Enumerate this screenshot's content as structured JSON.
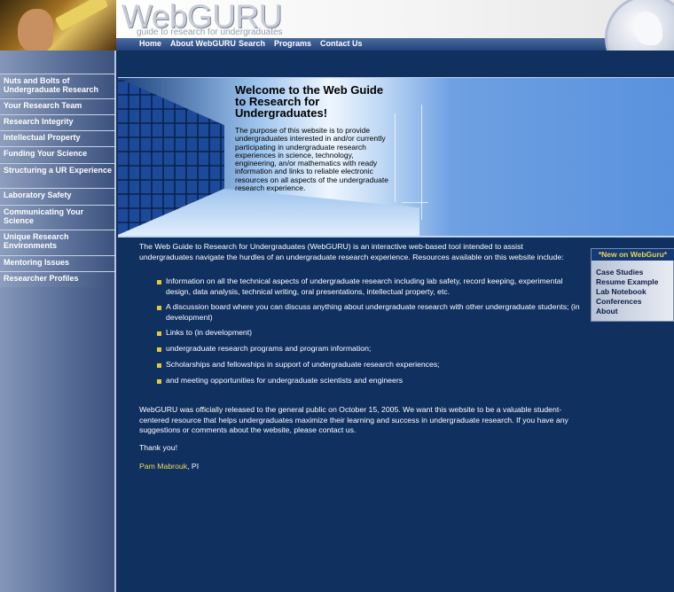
{
  "header": {
    "logo": "WebGURU",
    "tagline": "guide to research for undergraduates",
    "nav": [
      "Home",
      "About WebGURU",
      "Search",
      "Programs",
      "Contact Us"
    ]
  },
  "sidebar": {
    "items": [
      {
        "label": "Nuts and Bolts of Undergraduate Research"
      },
      {
        "label": "Your Research Team"
      },
      {
        "label": "Research Integrity"
      },
      {
        "label": "Intellectual Property"
      },
      {
        "label": "Funding Your Science"
      },
      {
        "label": "Structuring a UR Experience"
      },
      {
        "label": "Laboratory Safety"
      },
      {
        "label": "Communicating Your Science"
      },
      {
        "label": "Unique Research Environments"
      },
      {
        "label": "Mentoring Issues"
      },
      {
        "label": "Researcher Profiles"
      }
    ]
  },
  "hero": {
    "title": "Welcome to the Web Guide to Research for Undergraduates!",
    "text": "The purpose of this website is to provide undergraduates interested in and/or currently participating in undergraduate research experiences in science, technology, engineering, an/or mathematics with ready information and links to reliable electronic resources on all aspects of the undergraduate research experience."
  },
  "main": {
    "intro": "The Web Guide to Research for Undergraduates (WebGURU) is an interactive web-based tool intended to assist undergraduates navigate the hurdles of an undergraduate research experience. Resources available on this website include:",
    "bullets": [
      "Information on all the technical aspects of undergraduate research including lab safety, record keeping, experimental design, data analysis, technical writing, oral presentations, intellectual property, etc.",
      "A discussion board where you can discuss anything about undergraduate research with other undergraduate students; (in development)",
      "Links to (in development)",
      "undergraduate research programs and program information;",
      "Scholarships and fellowships in support of undergraduate research experiences;",
      "and meeting opportunities for undergraduate scientists and engineers"
    ],
    "para2": "WebGURU was officially released to the general public on October 15, 2005. We want this website to be a valuable student-centered resource that helps undergraduates maximize their learning and success in undergraduate research. If you have any suggestions or comments about the website, please contact us.",
    "thanks": "Thank you!",
    "author": "Pam Mabrouk",
    "author_suffix": ", PI"
  },
  "new_box": {
    "title": "*New on WebGuru*",
    "links": [
      "Case Studies",
      "Resume Example",
      "Lab Notebook",
      "Conferences",
      "About"
    ]
  },
  "colors": {
    "background": "#103060",
    "accent": "#f0d860",
    "bullet": "#e6c838"
  }
}
